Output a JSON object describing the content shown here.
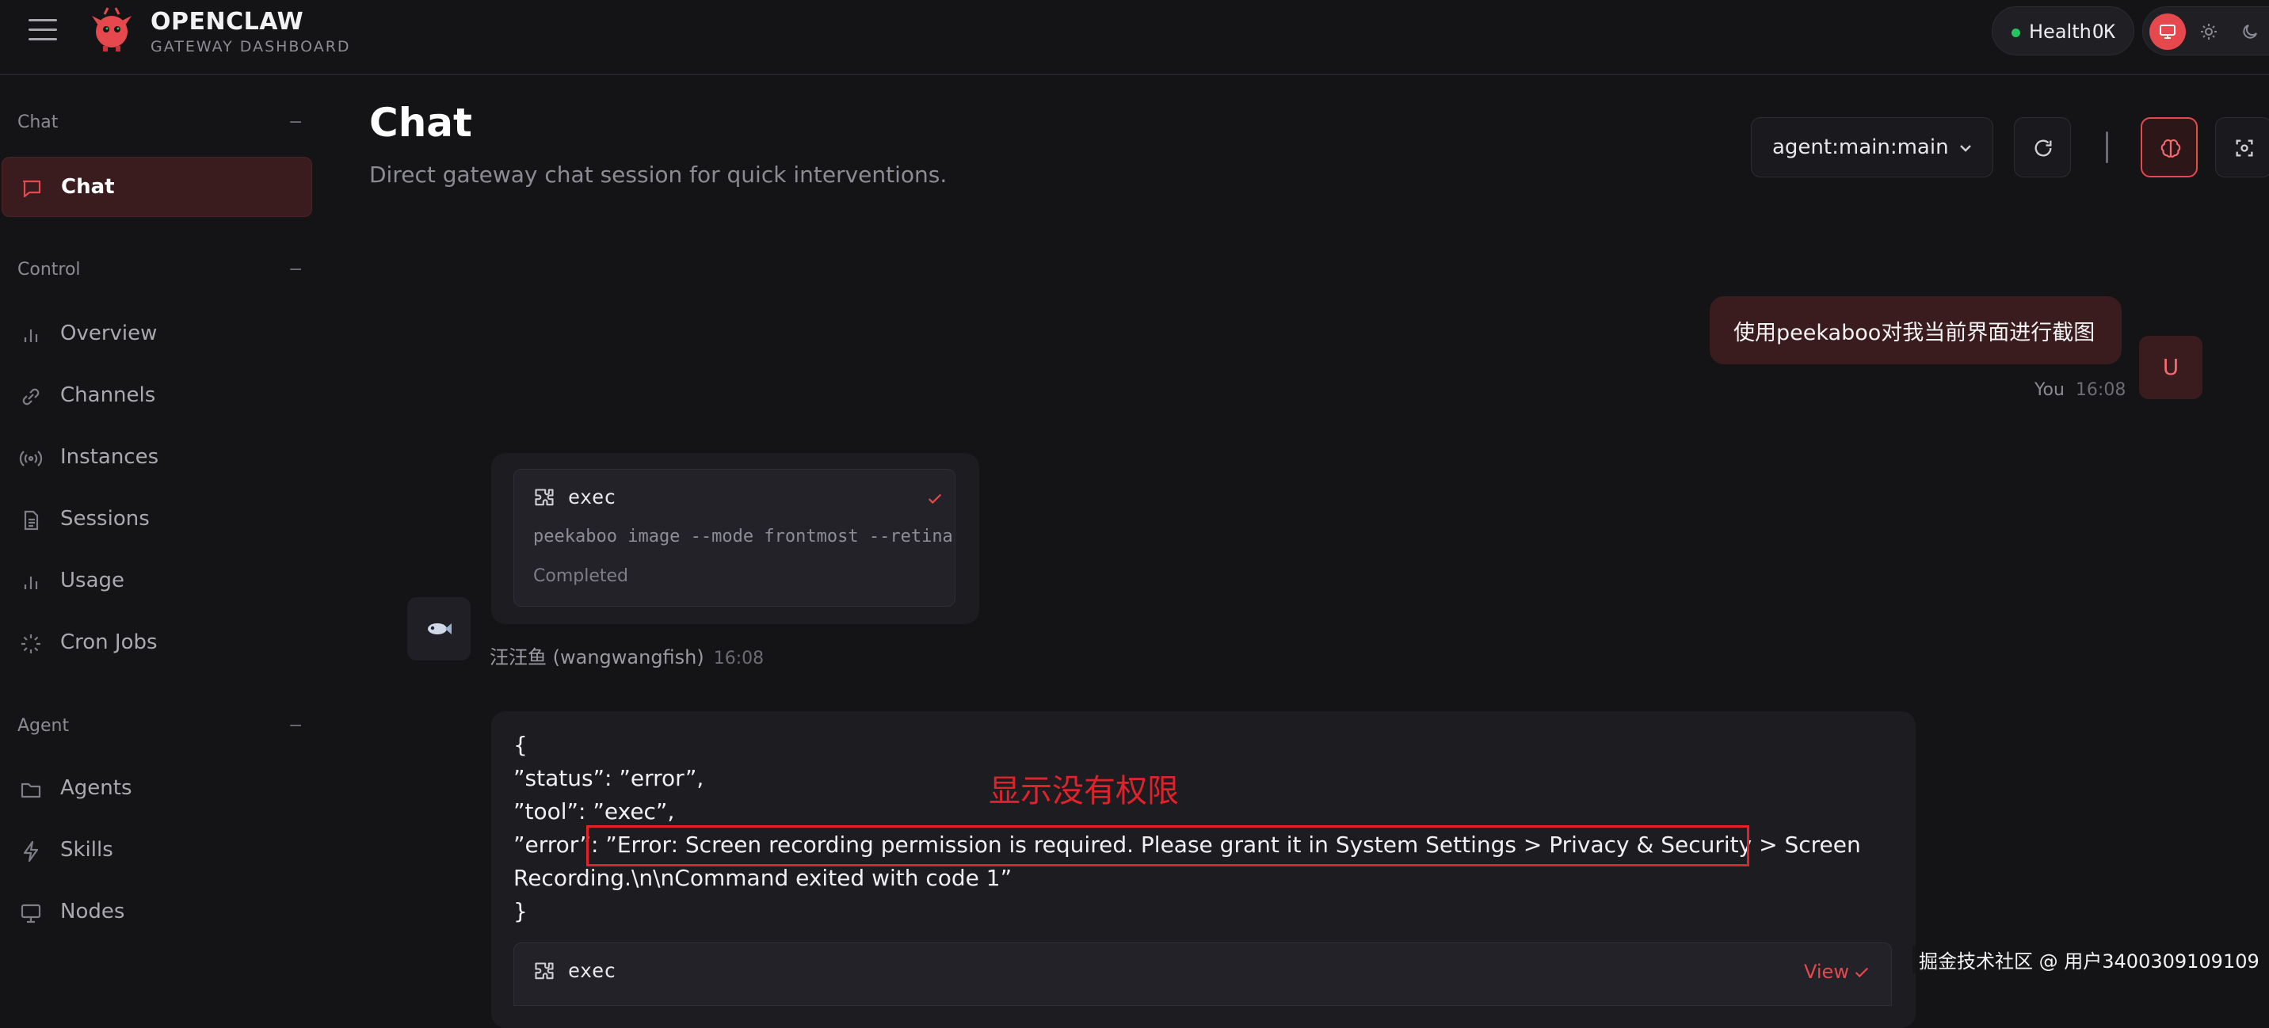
{
  "app": {
    "brand_title": "OPENCLAW",
    "brand_subtitle": "GATEWAY DASHBOARD",
    "health_label": "Health",
    "health_value": "OK",
    "health_status_color": "#22c55e",
    "accent_color": "#e5484d"
  },
  "sidebar": {
    "sections": [
      {
        "title": "Chat",
        "collapse": "−",
        "items": [
          {
            "label": "Chat",
            "icon": "chat-icon",
            "active": true
          }
        ]
      },
      {
        "title": "Control",
        "collapse": "−",
        "items": [
          {
            "label": "Overview",
            "icon": "bar-chart-icon"
          },
          {
            "label": "Channels",
            "icon": "link-icon"
          },
          {
            "label": "Instances",
            "icon": "radio-icon"
          },
          {
            "label": "Sessions",
            "icon": "file-icon"
          },
          {
            "label": "Usage",
            "icon": "bar-chart-icon"
          },
          {
            "label": "Cron Jobs",
            "icon": "loader-icon"
          }
        ]
      },
      {
        "title": "Agent",
        "collapse": "−",
        "items": [
          {
            "label": "Agents",
            "icon": "folder-icon"
          },
          {
            "label": "Skills",
            "icon": "zap-icon"
          },
          {
            "label": "Nodes",
            "icon": "monitor-icon"
          }
        ]
      }
    ]
  },
  "header": {
    "title": "Chat",
    "subtitle": "Direct gateway chat session for quick interventions.",
    "session_select_value": "agent:main:main"
  },
  "messages": {
    "user": {
      "text": "使用peekaboo对我当前界面进行截图",
      "sender": "You",
      "time": "16:08",
      "avatar_letter": "U"
    },
    "assistant": {
      "tool_name": "exec",
      "tool_command": "peekaboo image --mode frontmost --retina",
      "tool_status": "Completed",
      "sender": "汪汪鱼 (wangwangfish)",
      "time": "16:08"
    },
    "result": {
      "lines": [
        "{",
        "”status”: ”error”,",
        "”tool”: ”exec”,",
        "”error”: ”Error: Screen recording permission is required. Please grant it in System Settings > Privacy & Security > Screen",
        "Recording.\\n\\nCommand exited with code 1”",
        "}"
      ],
      "annotation": "显示没有权限",
      "exec_tool_name": "exec",
      "exec_view_label": "View"
    }
  },
  "watermark": "掘金技术社区 @ 用户3400309109109"
}
